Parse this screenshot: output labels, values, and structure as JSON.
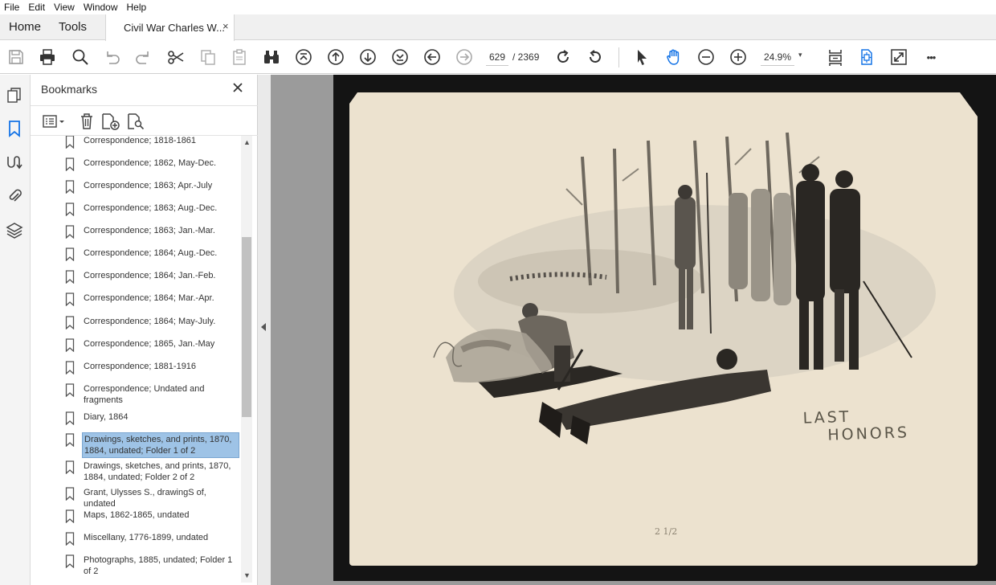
{
  "menu": [
    "File",
    "Edit",
    "View",
    "Window",
    "Help"
  ],
  "tabs": {
    "home": "Home",
    "tools": "Tools",
    "document": "Civil War Charles W...",
    "close": "×"
  },
  "toolbar": {
    "page_current": "629",
    "page_total": "/ 2369",
    "zoom": "24.9%",
    "zoom_caret": "▾",
    "more": "•••"
  },
  "bookmarks": {
    "title": "Bookmarks",
    "items": [
      {
        "label": "Correspondence; 1818-1861",
        "selected": false
      },
      {
        "label": "Correspondence; 1862, May-Dec.",
        "selected": false
      },
      {
        "label": "Correspondence; 1863; Apr.-July",
        "selected": false
      },
      {
        "label": "Correspondence; 1863; Aug.-Dec.",
        "selected": false
      },
      {
        "label": "Correspondence; 1863; Jan.-Mar.",
        "selected": false
      },
      {
        "label": "Correspondence; 1864; Aug.-Dec.",
        "selected": false
      },
      {
        "label": "Correspondence; 1864; Jan.-Feb.",
        "selected": false
      },
      {
        "label": "Correspondence; 1864; Mar.-Apr.",
        "selected": false
      },
      {
        "label": "Correspondence; 1864; May-July.",
        "selected": false
      },
      {
        "label": "Correspondence; 1865, Jan.-May",
        "selected": false
      },
      {
        "label": "Correspondence; 1881-1916",
        "selected": false
      },
      {
        "label": "Correspondence; Undated and fragments",
        "selected": false
      },
      {
        "label": "Diary, 1864",
        "selected": false
      },
      {
        "label": "Drawings, sketches, and prints, 1870, 1884, undated; Folder 1 of 2",
        "selected": true
      },
      {
        "label": "Drawings, sketches, and prints, 1870, 1884, undated; Folder 2 of 2",
        "selected": false
      },
      {
        "label": "Grant, Ulysses S., drawingS of, undated",
        "selected": false
      },
      {
        "label": "Maps, 1862-1865, undated",
        "selected": false
      },
      {
        "label": "Miscellany, 1776-1899, undated",
        "selected": false
      },
      {
        "label": "Photographs, 1885, undated; Folder 1 of 2",
        "selected": false
      }
    ]
  },
  "document": {
    "caption_line1": "LAST",
    "caption_line2": "HONORS",
    "page_mark": "2 1/2"
  },
  "colors": {
    "selection": "#9ec3e6",
    "accent": "#1473e6",
    "doc_bg": "#9b9b9b",
    "paper": "#ece2cf"
  }
}
